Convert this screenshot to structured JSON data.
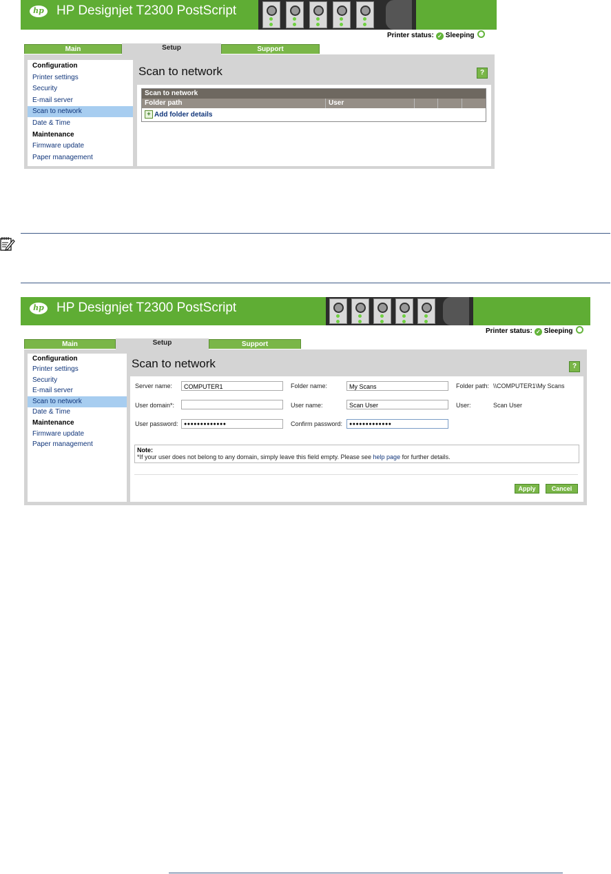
{
  "app": {
    "title": "HP Designjet T2300 PostScript"
  },
  "status": {
    "label": "Printer status:",
    "value": "Sleeping"
  },
  "tabs": [
    "Main",
    "Setup",
    "Support"
  ],
  "sidebar": {
    "items": [
      {
        "label": "Configuration",
        "type": "heading"
      },
      {
        "label": "Printer settings",
        "type": "link"
      },
      {
        "label": "Security",
        "type": "link"
      },
      {
        "label": "E-mail server",
        "type": "link"
      },
      {
        "label": "Scan to network",
        "type": "selected"
      },
      {
        "label": "Date & Time",
        "type": "link"
      },
      {
        "label": "Maintenance",
        "type": "heading"
      },
      {
        "label": "Firmware update",
        "type": "link"
      },
      {
        "label": "Paper management",
        "type": "link"
      }
    ]
  },
  "screen1": {
    "page_title": "Scan to network",
    "help": "?",
    "table": {
      "title": "Scan to network",
      "columns": [
        "Folder path",
        "User",
        "",
        "",
        ""
      ],
      "add_link": "Add folder details"
    }
  },
  "screen2": {
    "page_title": "Scan to network",
    "help": "?",
    "form": {
      "server_name_label": "Server name:",
      "server_name_value": "COMPUTER1",
      "folder_name_label": "Folder name:",
      "folder_name_value": "My Scans",
      "folder_path_label": "Folder path:",
      "folder_path_value": "\\\\COMPUTER1\\My Scans",
      "user_domain_label": "User domain*:",
      "user_domain_value": "",
      "user_name_label": "User name:",
      "user_name_value": "Scan User",
      "user_label": "User:",
      "user_value": "Scan User",
      "user_password_label": "User password:",
      "user_password_value": "●●●●●●●●●●●●●",
      "confirm_password_label": "Confirm password:",
      "confirm_password_value": "●●●●●●●●●●●●●"
    },
    "note": {
      "title": "Note:",
      "text_before": "*If your user does not belong to any domain, simply leave this field empty. Please see ",
      "link": "help page",
      "text_after": " for further details."
    },
    "buttons": {
      "apply": "Apply",
      "cancel": "Cancel"
    }
  },
  "colors": {
    "hp_green": "#5fad34",
    "tab_green": "#7ab648",
    "selected_blue": "#a7cdf0",
    "link_blue": "#10357a"
  }
}
